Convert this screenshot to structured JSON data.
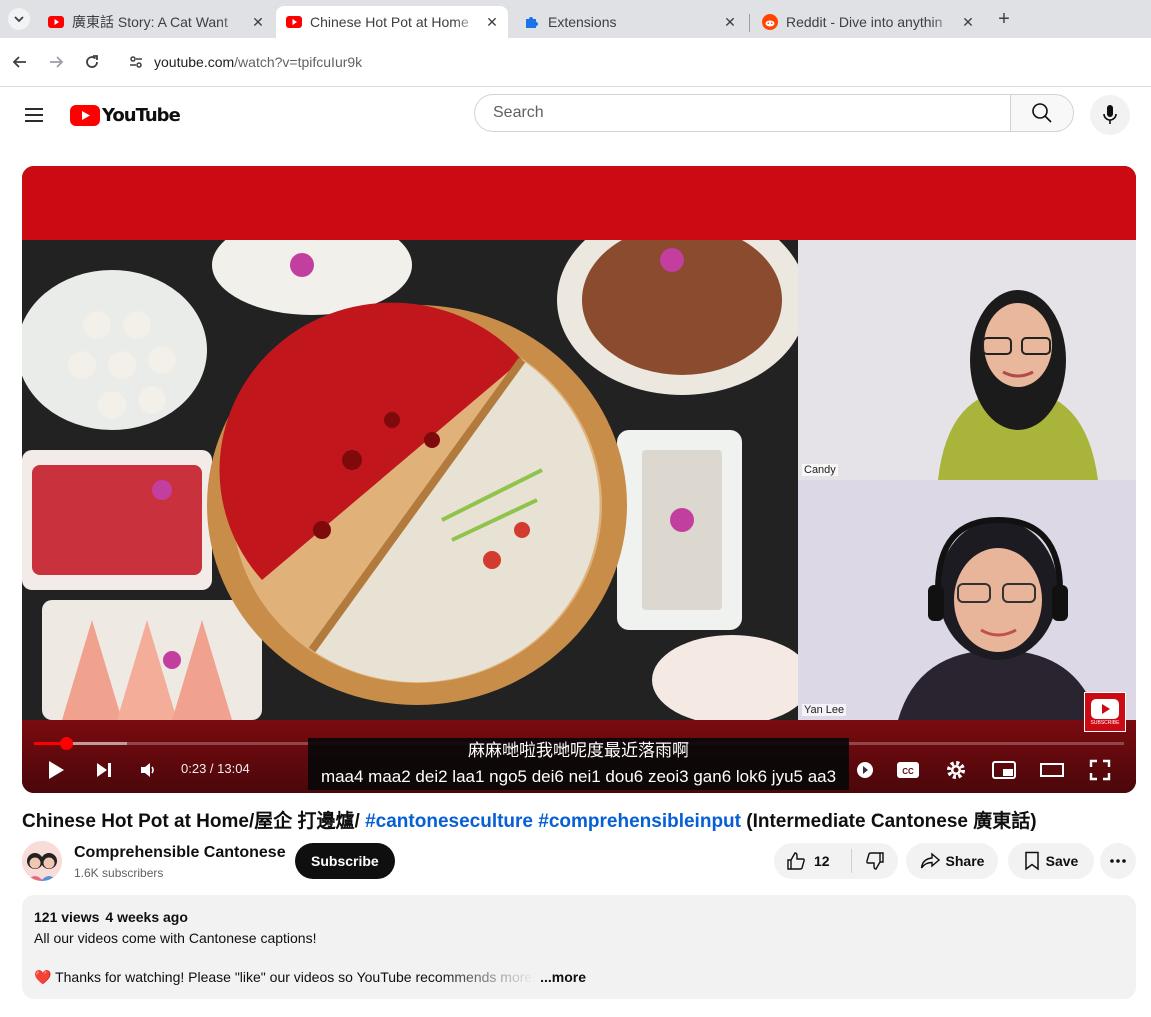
{
  "browser": {
    "tabs": [
      {
        "title": "廣東話 Story: A Cat Want",
        "favicon": "youtube-icon",
        "active": false
      },
      {
        "title": "Chinese Hot Pot at Home",
        "favicon": "youtube-icon",
        "active": true
      },
      {
        "title": "Extensions",
        "favicon": "puzzle-icon",
        "active": false
      },
      {
        "title": "Reddit - Dive into anythin",
        "favicon": "reddit-icon",
        "active": false
      }
    ],
    "url_host": "youtube.com",
    "url_path": "/watch?v=tpifcuIur9k"
  },
  "masthead": {
    "logo_text": "YouTube",
    "search_placeholder": "Search"
  },
  "player": {
    "time": "0:23 / 13:04",
    "progress_played_fraction": 0.029,
    "progress_loaded_fraction": 0.085,
    "captions": {
      "line1": "麻麻哋啦我哋呢度最近落雨啊",
      "line2": "maa4 maa2 dei2 laa1 ngo5 dei6 nei1 dou6 zeoi3 gan6 lok6 jyu5 aa3"
    },
    "speaker_labels": {
      "top": "Candy",
      "bottom": "Yan Lee"
    },
    "brand_badge_text": "SUBSCRIBE",
    "colors": {
      "brand_red": "#cc0a14",
      "progress_red": "#ff0000"
    }
  },
  "video": {
    "title_prefix": "Chinese Hot Pot at Home/屋企 打邊爐/ ",
    "hashtag1": "#cantoneseculture",
    "hashtag2": "#comprehensibleinput",
    "title_suffix": " (Intermediate Cantonese 廣東話)",
    "channel_name": "Comprehensible Cantonese",
    "subscriber_count": "1.6K subscribers",
    "subscribe_label": "Subscribe",
    "like_count": "12",
    "share_label": "Share",
    "save_label": "Save"
  },
  "description": {
    "views": "121 views",
    "age": "4 weeks ago",
    "line1": "All our videos come with Cantonese captions!",
    "line2": "❤️ Thanks for watching! Please \"like\" our videos so YouTube recommends more!",
    "more_label": "...more"
  }
}
